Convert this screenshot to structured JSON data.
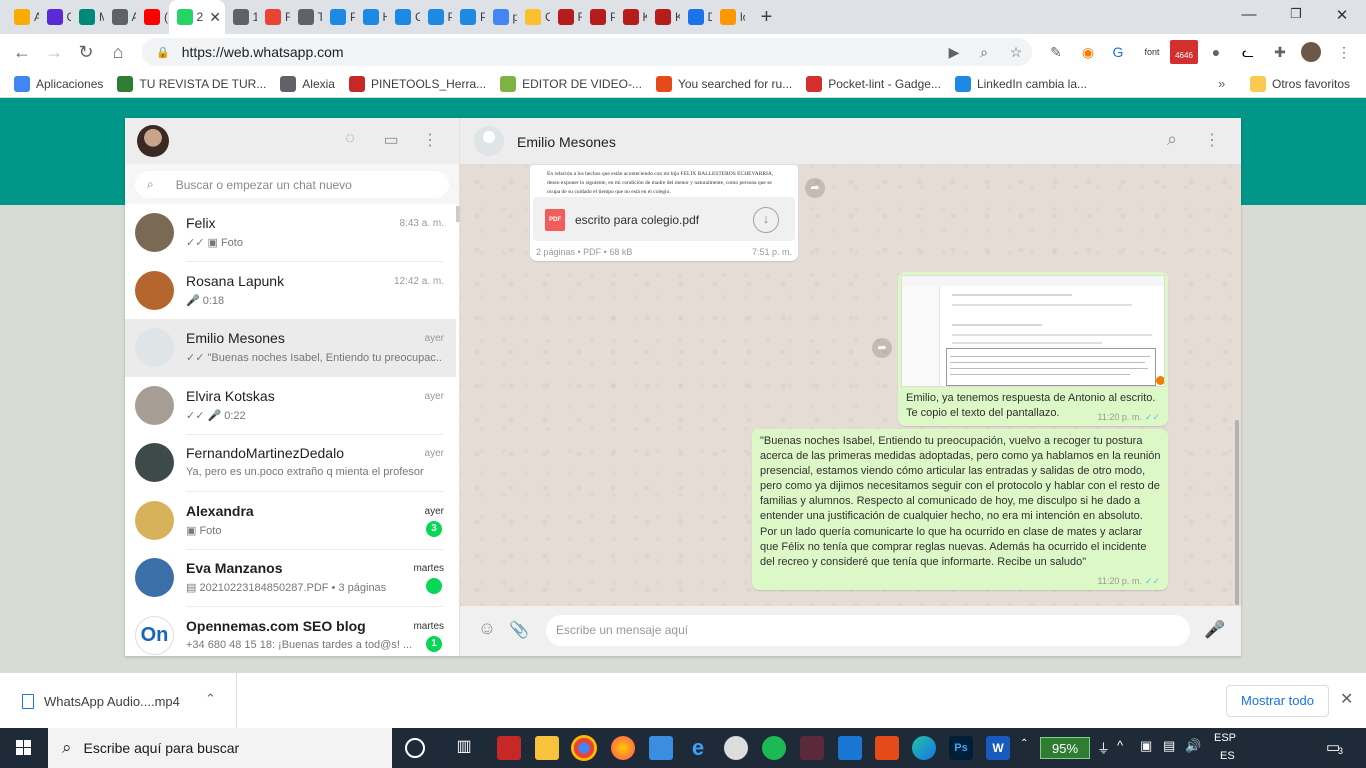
{
  "browser": {
    "tabs": [
      {
        "label": "Ar",
        "icon": "bar-chart-icon",
        "color": "#f9ab00"
      },
      {
        "label": "Cr",
        "icon": "dashlane-icon",
        "color": "#5b2ad6"
      },
      {
        "label": "M",
        "icon": "heart-icon",
        "color": "#00897b"
      },
      {
        "label": "Al",
        "icon": "globe-icon",
        "color": "#5f6368"
      },
      {
        "label": "(1:",
        "icon": "youtube-icon",
        "color": "#ff0000"
      },
      {
        "label": "2",
        "icon": "whatsapp-icon",
        "color": "#25d366",
        "active": true
      },
      {
        "label": "15",
        "icon": "globe-icon",
        "color": "#5f6368"
      },
      {
        "label": "Re",
        "icon": "gmail-icon",
        "color": "#ea4335"
      },
      {
        "label": "Te",
        "icon": "globe-icon",
        "color": "#5f6368"
      },
      {
        "label": "Pr",
        "icon": "cloud-icon",
        "color": "#1e88e5"
      },
      {
        "label": "Ha",
        "icon": "cloud-icon",
        "color": "#1e88e5"
      },
      {
        "label": "Ca",
        "icon": "cloud-icon",
        "color": "#1e88e5"
      },
      {
        "label": "PL",
        "icon": "cloud-icon",
        "color": "#1e88e5"
      },
      {
        "label": "PL",
        "icon": "cloud-icon",
        "color": "#1e88e5"
      },
      {
        "label": "pl",
        "icon": "google-icon",
        "color": "#4285f4"
      },
      {
        "label": "Cu",
        "icon": "sun-icon",
        "color": "#fbc02d"
      },
      {
        "label": "Fi",
        "icon": "bull-icon",
        "color": "#b71c1c"
      },
      {
        "label": "Pr",
        "icon": "bull-icon",
        "color": "#b71c1c"
      },
      {
        "label": "KC",
        "icon": "bull-icon",
        "color": "#b71c1c"
      },
      {
        "label": "KC",
        "icon": "bull-icon",
        "color": "#b71c1c"
      },
      {
        "label": "De",
        "icon": "download-icon",
        "color": "#1a73e8"
      },
      {
        "label": "lo",
        "icon": "m-icon",
        "color": "#ff9800"
      }
    ],
    "url": "https://web.whatsapp.com",
    "bookmarks": [
      {
        "label": "Aplicaciones",
        "color": "#4285f4"
      },
      {
        "label": "TU REVISTA DE TUR...",
        "color": "#2e7d32"
      },
      {
        "label": "Alexia",
        "color": "#5f6368"
      },
      {
        "label": "PINETOOLS_Herra...",
        "color": "#c62828"
      },
      {
        "label": "EDITOR DE VIDEO-...",
        "color": "#7cb342"
      },
      {
        "label": "You searched for ru...",
        "color": "#e64a19"
      },
      {
        "label": "Pocket-lint - Gadge...",
        "color": "#d32f2f"
      },
      {
        "label": "LinkedIn cambia la...",
        "color": "#1e88e5"
      }
    ],
    "other_bookmarks": "Otros favoritos",
    "ext_badge": "4646",
    "ext_font_label": "font"
  },
  "sidebar": {
    "search_placeholder": "Buscar o empezar un chat nuevo",
    "chats": [
      {
        "name": "Felix",
        "time": "8:43 a. m.",
        "preview": "✓✓ ▣ Foto",
        "bold": false,
        "badge": "",
        "avatar": "#7a6a55"
      },
      {
        "name": "Rosana Lapunk",
        "time": "12:42 a. m.",
        "preview": "🎤 0:18",
        "bold": false,
        "badge": "",
        "avatar": "#b5662e"
      },
      {
        "name": "Emilio Mesones",
        "time": "ayer",
        "preview": "✓✓ \"Buenas noches Isabel, Entiendo tu preocupac...",
        "bold": false,
        "badge": "",
        "avatar": "#dfe5e7",
        "selected": true
      },
      {
        "name": "Elvira Kotskas",
        "time": "ayer",
        "preview": "✓✓ 🎤 0:22",
        "bold": false,
        "badge": "",
        "avatar": "#a69e94"
      },
      {
        "name": "FernandoMartinezDedalo",
        "time": "ayer",
        "preview": "Ya, pero es un.poco extraño q mienta el profesor",
        "bold": false,
        "badge": "",
        "avatar": "#3d4a4a"
      },
      {
        "name": "Alexandra",
        "time": "ayer",
        "preview": "▣ Foto",
        "bold": true,
        "badge": "3",
        "avatar": "#d8b25b"
      },
      {
        "name": "Eva Manzanos",
        "time": "martes",
        "preview": "▤ 20210223184850287.PDF • 3 páginas",
        "bold": true,
        "badge": " ",
        "avatar": "#3b6fa8"
      },
      {
        "name": "Opennemas.com SEO blog",
        "time": "martes",
        "preview": "+34 680 48 15 18: ¡Buenas tardes a tod@s! ...",
        "bold": true,
        "badge": "1",
        "avatar": "#ffffff"
      }
    ]
  },
  "conversation": {
    "contact_name": "Emilio Mesones",
    "pdf_preview_text": "En relación a los hechos que están aconteciendo con mi hijo FELIX BALLESTEROS ECHEVARRIA, deseo exponer lo siguiente, en mi condición de madre del menor y naturalmente, como persona que se ocupa de su cuidado el tiempo que no está en el colegio.",
    "pdf_icon_label": "PDF",
    "pdf_name": "escrito para colegio.pdf",
    "pdf_meta": "2 páginas • PDF • 68 kB",
    "pdf_time": "7:51 p. m.",
    "image_caption": "Emilio, ya tenemos respuesta de Antonio al escrito. Te copio el texto del pantallazo.",
    "image_time": "11:20 p. m.",
    "long_message": "\"Buenas noches Isabel, Entiendo tu preocupación, vuelvo a recoger tu postura acerca de las primeras medidas adoptadas, pero como ya hablamos en la reunión presencial, estamos viendo cómo articular las entradas y salidas de otro modo, pero como ya dijimos necesitamos seguir con el protocolo y hablar con el resto de familias y alumnos. Respecto al comunicado de hoy, me disculpo si he dado a entender una justificación de cualquier hecho, no era mi intención en absoluto. Por un lado quería comunicarte lo que ha ocurrido en clase de mates y aclarar que Félix no tenía que comprar reglas nuevas. Además ha ocurrido el incidente del recreo y consideré que tenía que informarte. Recibe un saludo\"",
    "long_time": "11:20 p. m.",
    "input_placeholder": "Escribe un mensaje aquí"
  },
  "downloads": {
    "file": "WhatsApp Audio....mp4",
    "show_all": "Mostrar todo"
  },
  "taskbar": {
    "search_placeholder": "Escribe aquí para buscar",
    "battery": "95%",
    "lang": "ESP",
    "lang2": "ES",
    "notif_count": "3"
  },
  "colors": {
    "wa_green": "#009688",
    "bubble_out": "#dcf8c6",
    "unread": "#06d755"
  }
}
